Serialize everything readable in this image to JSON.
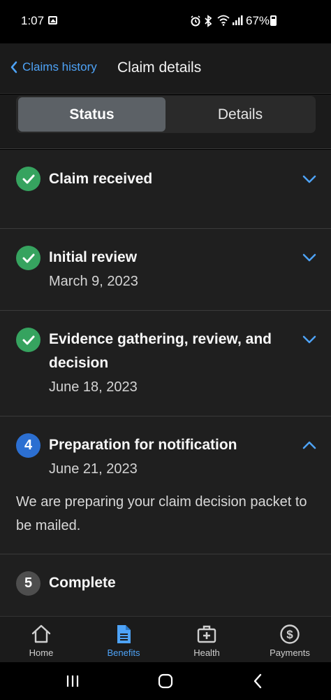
{
  "status_bar": {
    "time": "1:07",
    "battery": "67%"
  },
  "header": {
    "back_label": "Claims history",
    "title": "Claim details"
  },
  "tabs": {
    "status": "Status",
    "details": "Details",
    "selected": "Status"
  },
  "steps": [
    {
      "state": "done",
      "title": "Claim received",
      "date": "",
      "expanded": false
    },
    {
      "state": "done",
      "title": "Initial review",
      "date": "March 9, 2023",
      "expanded": false
    },
    {
      "state": "done",
      "title": "Evidence gathering, review, and decision",
      "date": "June 18, 2023",
      "expanded": false
    },
    {
      "state": "active",
      "number": "4",
      "title": "Preparation for notification",
      "date": "June 21, 2023",
      "description": "We are preparing your claim decision packet to be mailed.",
      "expanded": true
    },
    {
      "state": "pending",
      "number": "5",
      "title": "Complete",
      "date": ""
    }
  ],
  "bottom_nav": [
    {
      "label": "Home",
      "icon": "home-icon"
    },
    {
      "label": "Benefits",
      "icon": "document-icon",
      "selected": true
    },
    {
      "label": "Health",
      "icon": "medical-kit-icon"
    },
    {
      "label": "Payments",
      "icon": "dollar-circle-icon"
    }
  ],
  "colors": {
    "accent": "#4ea3f7",
    "done": "#36a35f",
    "active": "#2c6fd1",
    "pending": "#4e4e4e"
  }
}
